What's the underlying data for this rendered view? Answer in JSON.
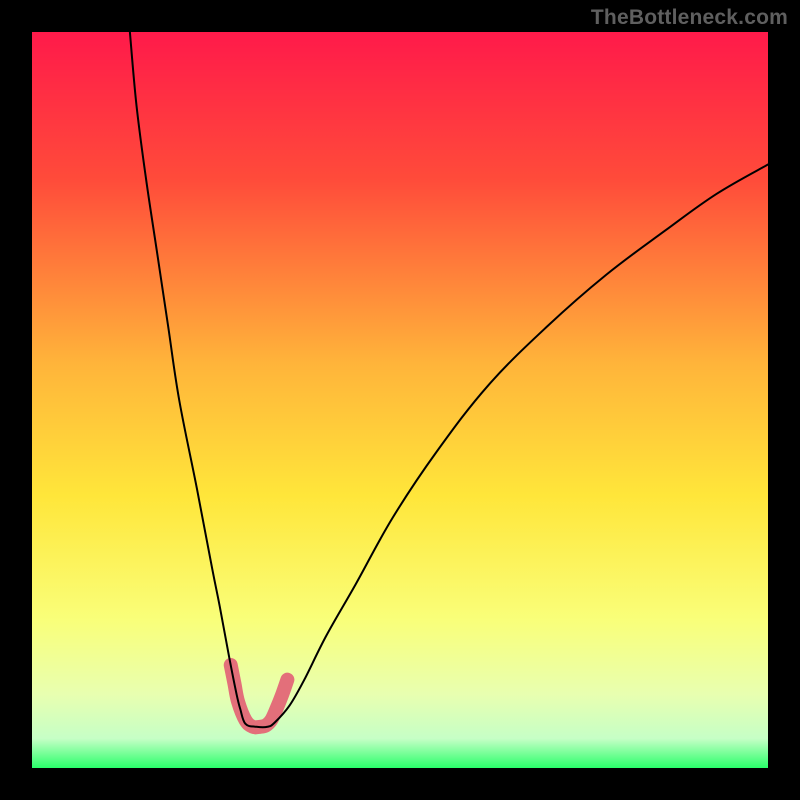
{
  "watermark": "TheBottleneck.com",
  "gradient": {
    "stops": [
      {
        "offset": 0.0,
        "color": "#ff1a4a"
      },
      {
        "offset": 0.2,
        "color": "#ff4b3a"
      },
      {
        "offset": 0.45,
        "color": "#ffb43a"
      },
      {
        "offset": 0.63,
        "color": "#ffe63a"
      },
      {
        "offset": 0.8,
        "color": "#f9ff7a"
      },
      {
        "offset": 0.9,
        "color": "#e8ffb0"
      },
      {
        "offset": 0.96,
        "color": "#c6ffc6"
      },
      {
        "offset": 1.0,
        "color": "#2aff6a"
      }
    ]
  },
  "chart_data": {
    "type": "line",
    "title": "",
    "xlabel": "",
    "ylabel": "",
    "xlim": [
      0,
      100
    ],
    "ylim": [
      0,
      100
    ],
    "series": [
      {
        "name": "curve",
        "x": [
          13.3,
          14.2,
          15.5,
          17.0,
          18.5,
          20.0,
          22.4,
          24.5,
          25.5,
          26.8,
          27.8,
          28.3,
          29.0,
          30.5,
          32.0,
          33.0,
          35.0,
          37.0,
          40.0,
          44.0,
          49.0,
          55.0,
          62.0,
          70.0,
          78.0,
          86.0,
          93.0,
          100.0
        ],
        "y": [
          100.0,
          90.0,
          80.0,
          70.0,
          60.0,
          50.0,
          38.0,
          27.0,
          22.0,
          15.0,
          10.0,
          8.0,
          6.0,
          5.6,
          5.6,
          6.2,
          8.5,
          12.0,
          18.0,
          25.0,
          34.0,
          43.0,
          52.0,
          60.0,
          67.0,
          73.0,
          78.0,
          82.0
        ]
      },
      {
        "name": "bottleneck-highlight",
        "x": [
          27.0,
          27.5,
          28.0,
          29.0,
          30.0,
          31.0,
          31.8,
          32.5,
          33.2,
          34.0,
          34.7
        ],
        "y": [
          14.0,
          11.5,
          9.0,
          6.5,
          5.6,
          5.6,
          5.8,
          6.5,
          8.0,
          10.0,
          12.0
        ]
      }
    ]
  },
  "styles": {
    "curve": {
      "stroke": "#000000",
      "width": 2.0
    },
    "highlight": {
      "stroke": "#e36f7a",
      "width": 14
    }
  }
}
